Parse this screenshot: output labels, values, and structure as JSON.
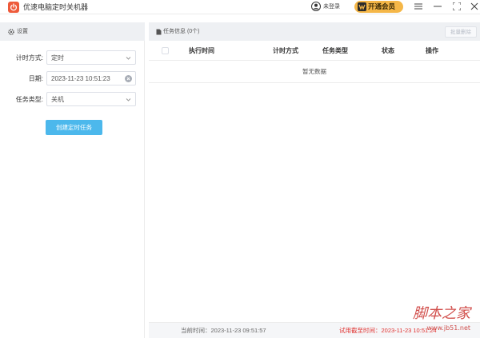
{
  "app": {
    "title": "优速电脑定时关机器",
    "user_label": "未登录",
    "vip_label": "开通会员"
  },
  "settings": {
    "header": "设置",
    "timing_mode_label": "计时方式:",
    "timing_mode_value": "定时",
    "date_label": "日期:",
    "date_value": "2023-11-23 10:51:23",
    "task_type_label": "任务类型:",
    "task_type_value": "关机",
    "create_button": "创建定时任务"
  },
  "tasks": {
    "header": "任务信息",
    "count": "(0个)",
    "batch_delete": "批量删除",
    "columns": [
      "执行时间",
      "计时方式",
      "任务类型",
      "状态",
      "操作"
    ],
    "empty_text": "暂无数据"
  },
  "status": {
    "current_time": "当前时间：2023-11-23 09:51:57",
    "trial_deadline": "试用截至时间：2023-11-23 10:51:24"
  },
  "watermark": {
    "text": "脚本之家",
    "url": "www.jb51.net"
  },
  "colors": {
    "accent": "#4cb8ec",
    "vip": "#f5b748",
    "logo": "#ee5a3a",
    "trial_text": "#e0312f",
    "panel_header": "#eef0f3"
  },
  "icons": {
    "logo": "power-icon",
    "user": "user-icon",
    "vip": "vip-crown-icon",
    "menu": "menu-icon",
    "minimize": "minimize-icon",
    "maximize": "maximize-icon",
    "close": "close-icon",
    "settings": "gear-icon",
    "tasks": "document-icon"
  }
}
